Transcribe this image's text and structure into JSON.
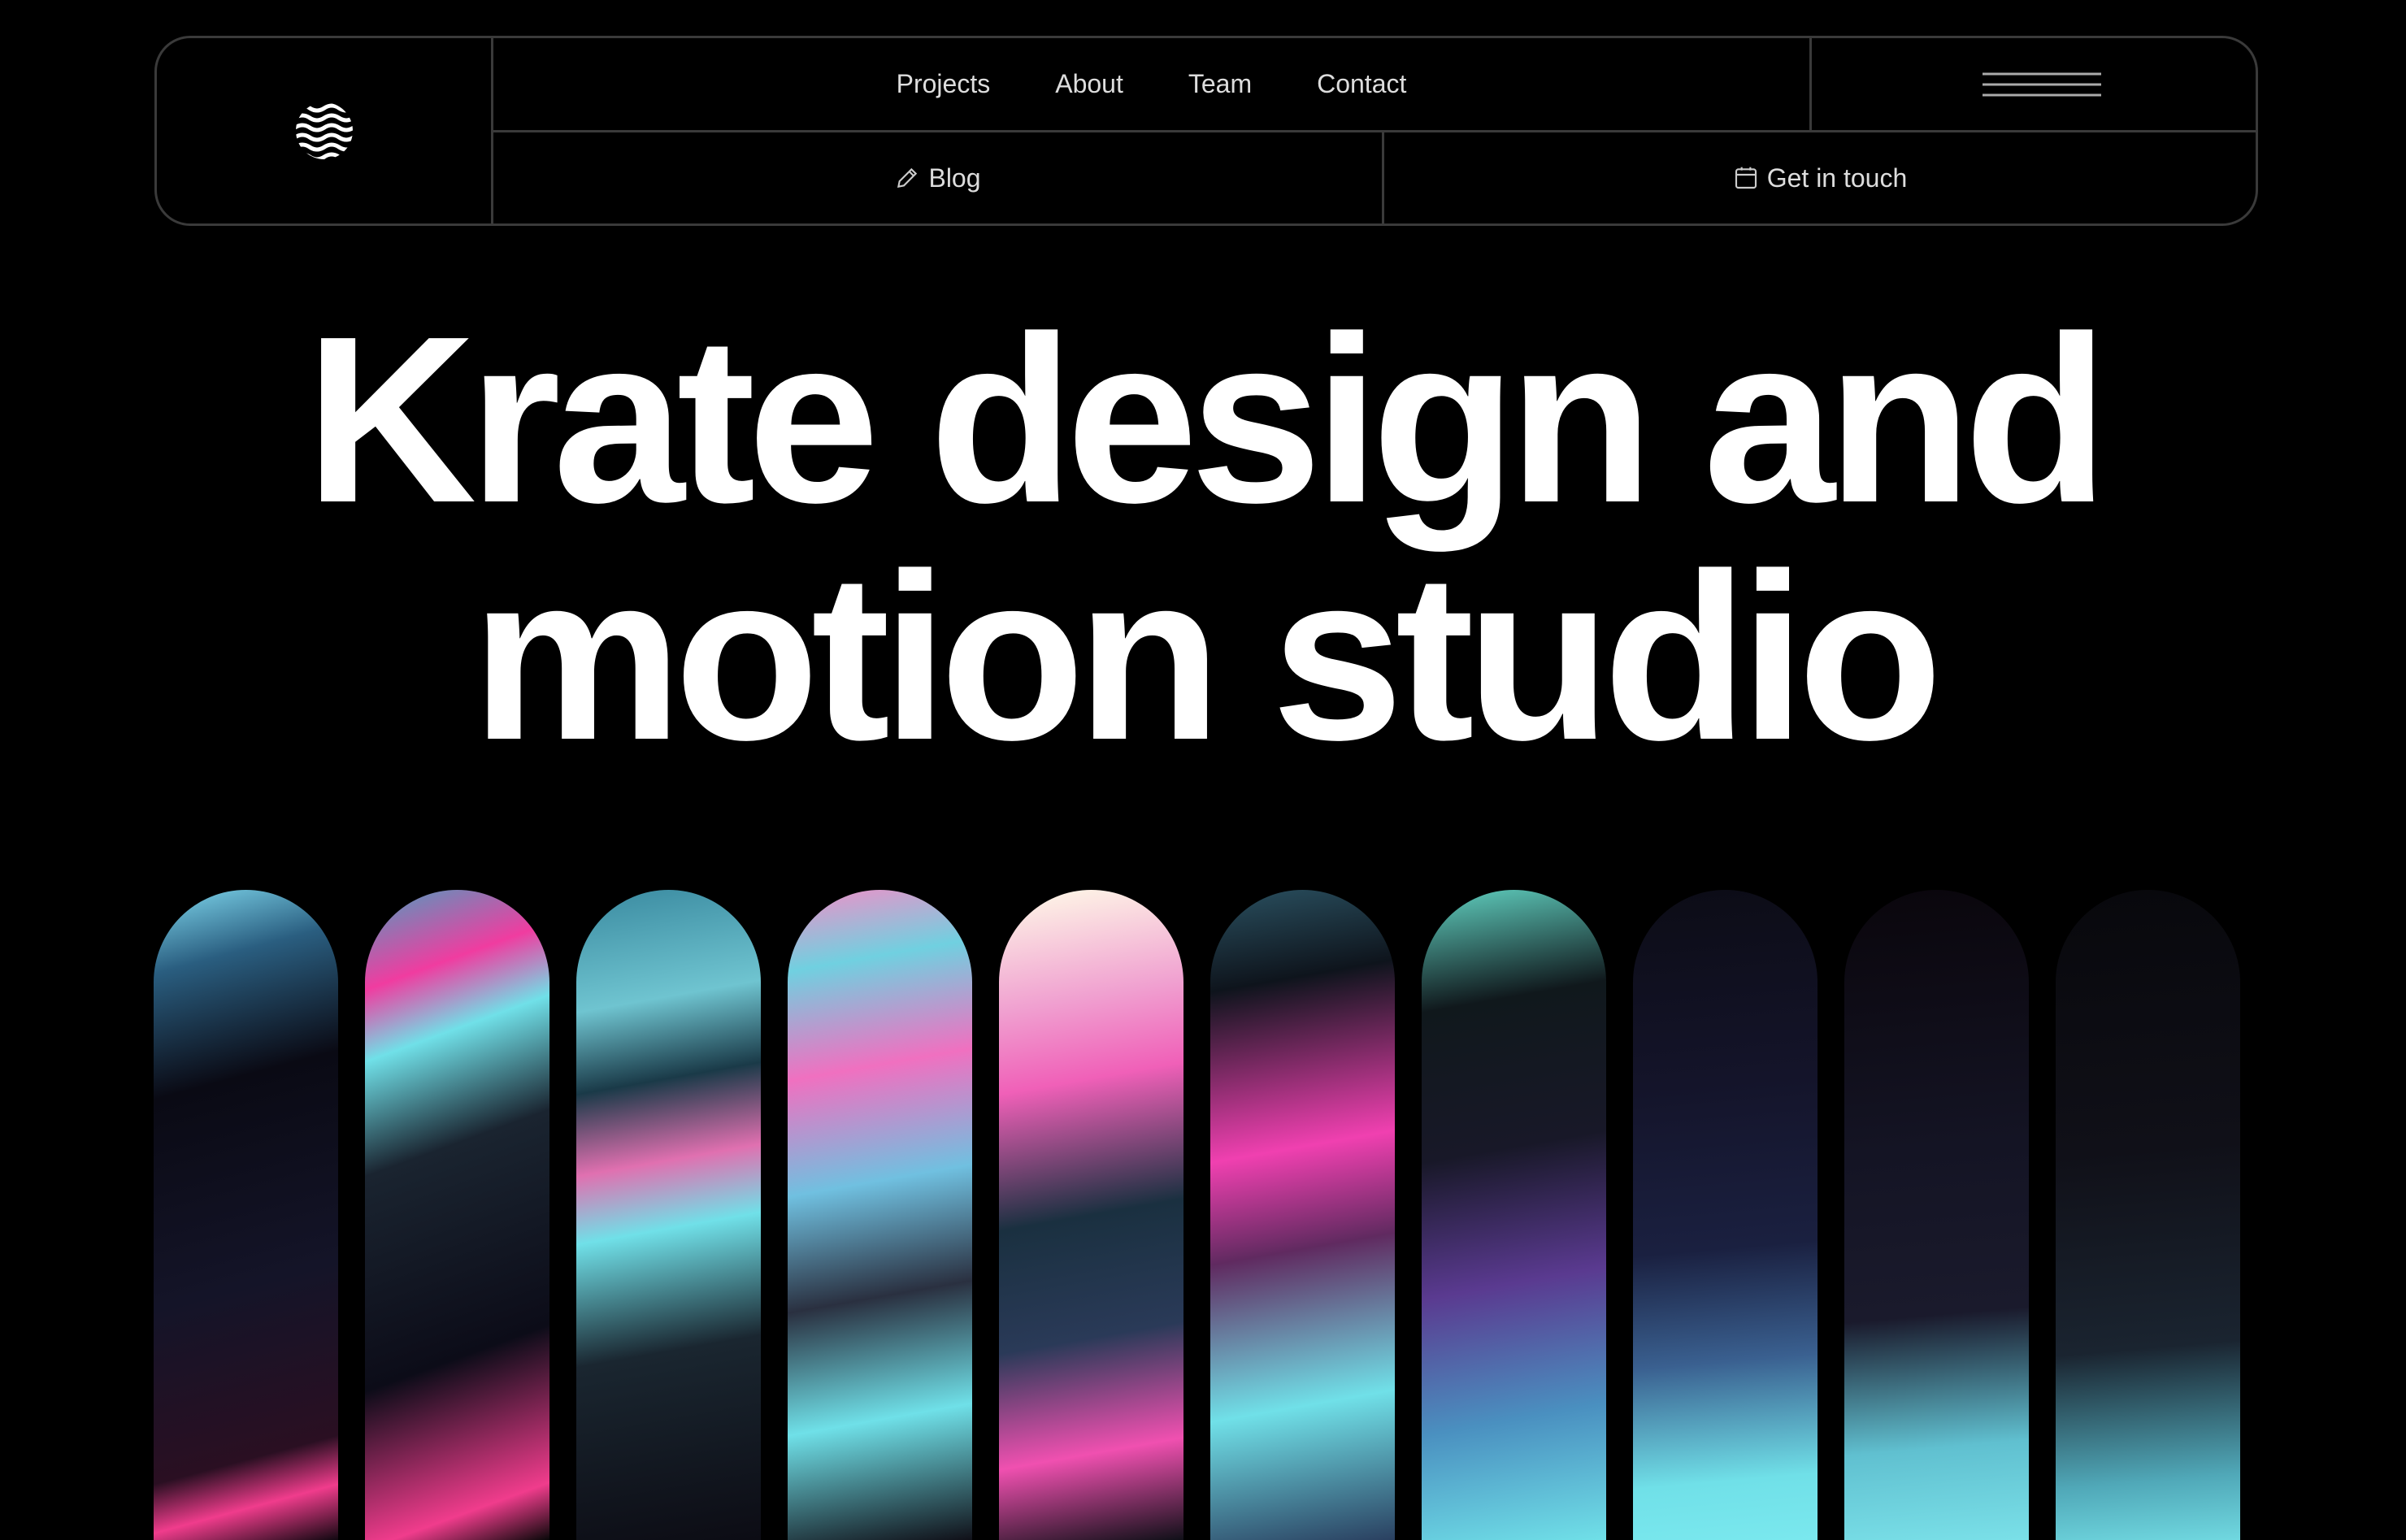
{
  "nav": {
    "links": [
      "Projects",
      "About",
      "Team",
      "Contact"
    ],
    "blog": "Blog",
    "contact_cta": "Get in touch"
  },
  "hero": {
    "line1": "Krate design and",
    "line2": "motion studio"
  },
  "colors": {
    "cyan": "#6fe3e8",
    "pink": "#f03ca0",
    "background": "#000000",
    "border": "#3a3a3a"
  }
}
